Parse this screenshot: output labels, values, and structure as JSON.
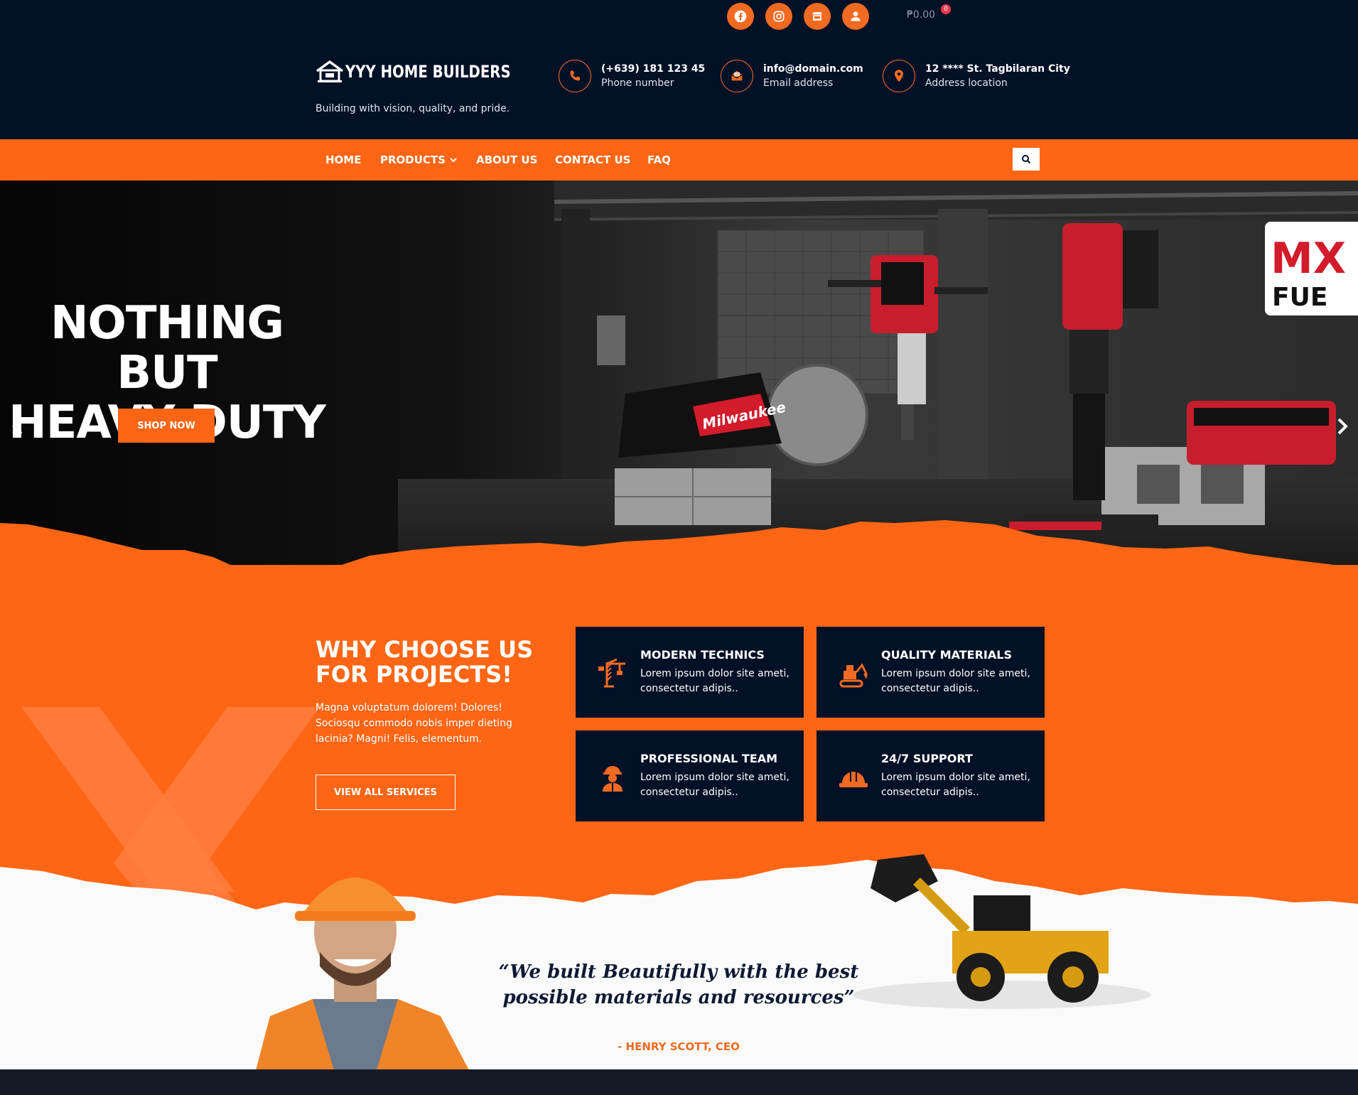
{
  "header": {
    "cart_amount": "₱0.00",
    "cart_count": "0",
    "logo_text": "YYY HOME BUILDERS",
    "tagline": "Building with vision, quality, and pride.",
    "contacts": [
      {
        "title": "(+639) 181 123 45",
        "sub": "Phone number",
        "icon": "phone-icon"
      },
      {
        "title": "info@domain.com",
        "sub": "Email address",
        "icon": "email-icon"
      },
      {
        "title": "12 **** St. Tagbilaran City",
        "sub": "Address location",
        "icon": "location-icon"
      }
    ],
    "social_icons": [
      "facebook-icon",
      "instagram-icon",
      "store-icon",
      "user-icon"
    ]
  },
  "nav": {
    "items": [
      "HOME",
      "PRODUCTS",
      "ABOUT US",
      "CONTACT US",
      "FAQ"
    ],
    "search_icon": "search-icon"
  },
  "hero": {
    "title_line1": "NOTHING BUT",
    "title_line2": "HEAVY DUTY",
    "button": "SHOP NOW",
    "brand_badge_line1": "MX",
    "brand_badge_line2": "FUE",
    "tool_brand": "Milwaukee"
  },
  "why": {
    "title_line1": "WHY CHOOSE US",
    "title_line2": "FOR PROJECTS!",
    "text": "Magna voluptatum dolorem! Dolores! Sociosqu commodo nobis imper dieting lacinia? Magni! Felis, elementum.",
    "button": "VIEW ALL SERVICES",
    "cards": [
      {
        "title": "MODERN TECHNICS",
        "text": "Lorem ipsum dolor site ameti, consectetur adipis..",
        "icon": "crane-icon"
      },
      {
        "title": "QUALITY MATERIALS",
        "text": "Lorem ipsum dolor site ameti, consectetur adipis..",
        "icon": "excavator-icon"
      },
      {
        "title": "PROFESSIONAL TEAM",
        "text": "Lorem ipsum dolor site ameti, consectetur adipis..",
        "icon": "worker-icon"
      },
      {
        "title": "24/7 SUPPORT",
        "text": "Lorem ipsum dolor site ameti, consectetur adipis..",
        "icon": "hardhat-icon"
      }
    ]
  },
  "testimonial": {
    "quote_line1": "“We built Beautifully with the best",
    "quote_line2": "possible materials and resources”",
    "author": "- HENRY SCOTT, CEO"
  },
  "colors": {
    "navy": "#031127",
    "orange": "#fe6615",
    "white": "#ffffff"
  }
}
